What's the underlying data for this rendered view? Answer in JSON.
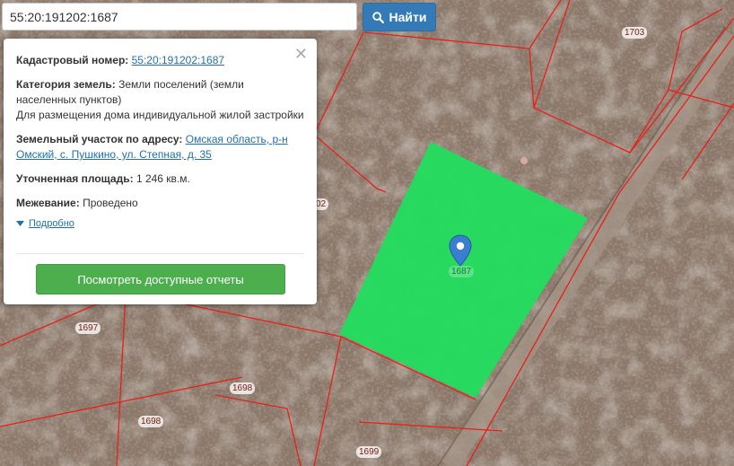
{
  "search": {
    "value": "55:20:191202:1687",
    "button_label": "Найти"
  },
  "popup": {
    "cadastral_label": "Кадастровый номер:",
    "cadastral_value": "55:20:191202:1687",
    "category_label": "Категория земель:",
    "category_value": "Земли поселений (земли населенных пунктов)",
    "category_use": "Для размещения дома индивидуальной жилой застройки",
    "address_label": "Земельный участок по адресу:",
    "address_value": "Омская область, р-н Омский, с. Пушкино, ул. Степная, д. 35",
    "area_label": "Уточненная площадь:",
    "area_value": "1 246 кв.м.",
    "survey_label": "Межевание:",
    "survey_value": "Проведено",
    "details_label": "Подробно",
    "report_button": "Посмотреть доступные отчеты"
  },
  "map": {
    "parcel_labels": [
      "1703",
      "02",
      "1697",
      "1698",
      "1698",
      "1699",
      "1687"
    ],
    "selected_parcel_color": "#22dd5e",
    "boundary_color": "#e8201a",
    "marker_color": "#3a7fcf"
  }
}
